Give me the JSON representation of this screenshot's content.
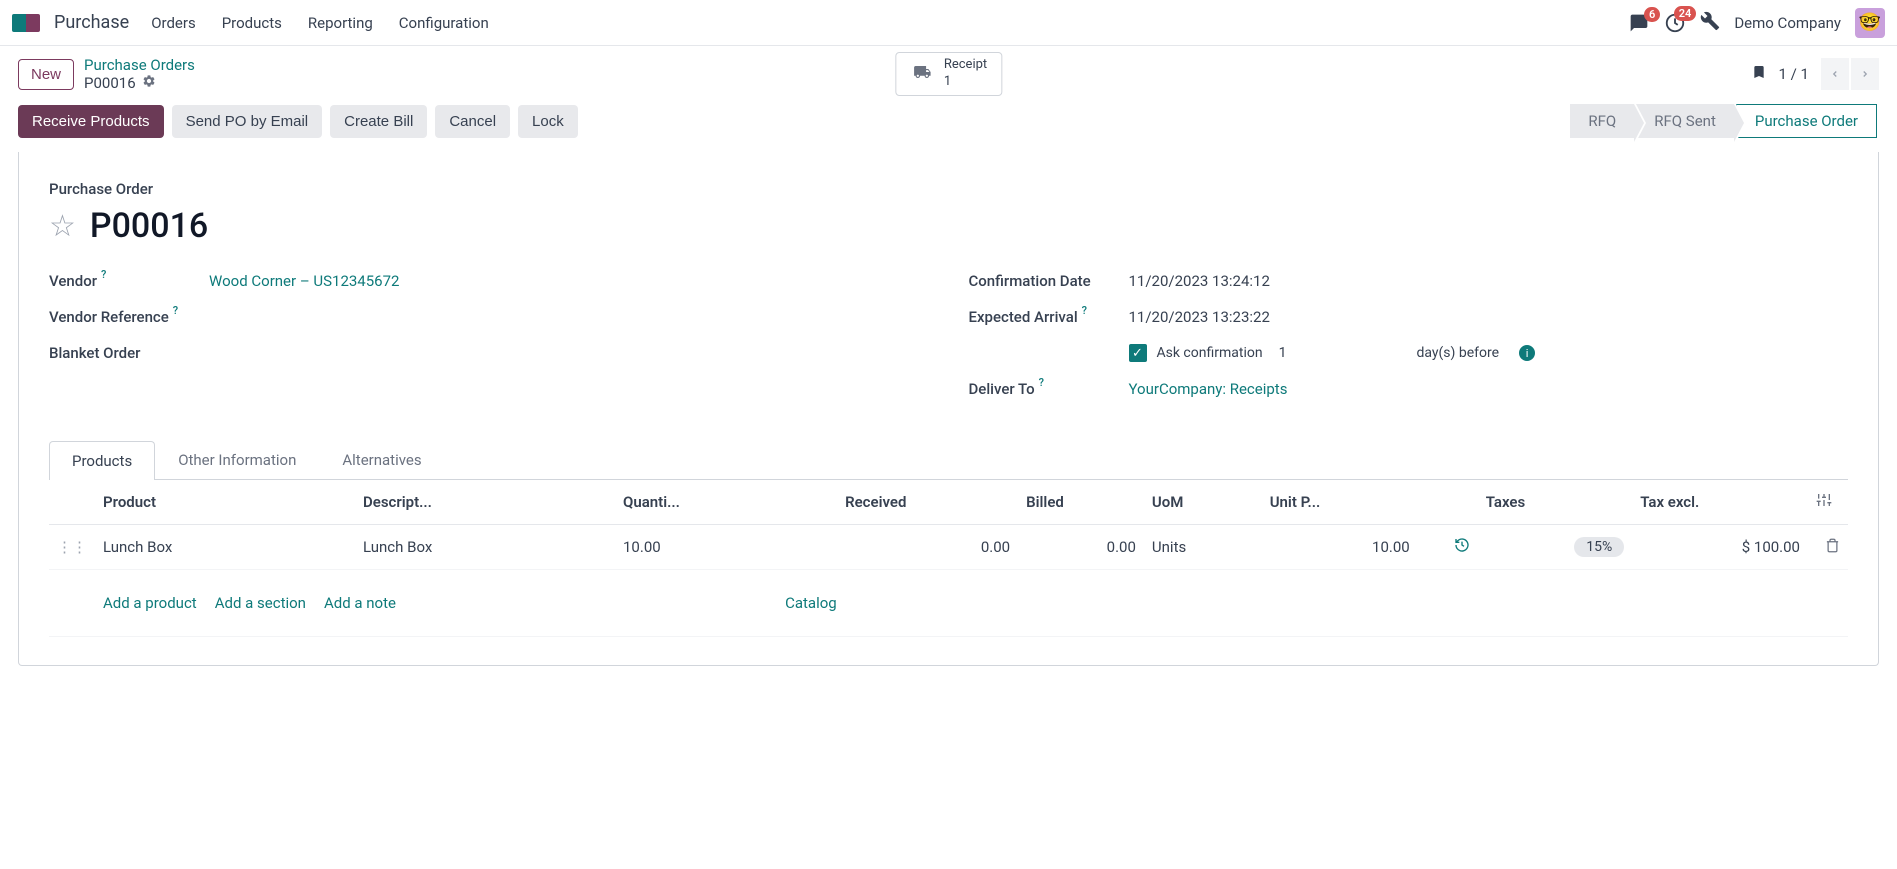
{
  "nav": {
    "app": "Purchase",
    "menu": [
      "Orders",
      "Products",
      "Reporting",
      "Configuration"
    ],
    "chat_badge": "6",
    "activity_badge": "24",
    "company": "Demo Company"
  },
  "breadcrumb": {
    "new_btn": "New",
    "parent": "Purchase Orders",
    "current": "P00016",
    "receipt_label": "Receipt",
    "receipt_count": "1",
    "pager": "1 / 1"
  },
  "actions": {
    "receive": "Receive Products",
    "send_po": "Send PO by Email",
    "create_bill": "Create Bill",
    "cancel": "Cancel",
    "lock": "Lock"
  },
  "status": {
    "rfq": "RFQ",
    "rfq_sent": "RFQ Sent",
    "po": "Purchase Order"
  },
  "header": {
    "label": "Purchase Order",
    "name": "P00016"
  },
  "fields": {
    "vendor_label": "Vendor",
    "vendor_value": "Wood Corner – US12345672",
    "vendor_ref_label": "Vendor Reference",
    "blanket_label": "Blanket Order",
    "confirm_date_label": "Confirmation Date",
    "confirm_date_value": "11/20/2023 13:24:12",
    "expected_label": "Expected Arrival",
    "expected_value": "11/20/2023 13:23:22",
    "ask_confirm_label": "Ask confirmation",
    "ask_confirm_days": "1",
    "days_before": "day(s) before",
    "deliver_to_label": "Deliver To",
    "deliver_to_value": "YourCompany: Receipts"
  },
  "tabs": {
    "products": "Products",
    "other": "Other Information",
    "alternatives": "Alternatives"
  },
  "table": {
    "headers": {
      "product": "Product",
      "description": "Descript...",
      "quantity": "Quanti...",
      "received": "Received",
      "billed": "Billed",
      "uom": "UoM",
      "unit_price": "Unit P...",
      "taxes": "Taxes",
      "tax_excl": "Tax excl."
    },
    "rows": [
      {
        "product": "Lunch Box",
        "description": "Lunch Box",
        "quantity": "10.00",
        "received": "0.00",
        "billed": "0.00",
        "uom": "Units",
        "unit_price": "10.00",
        "taxes": "15%",
        "tax_excl": "$ 100.00"
      }
    ],
    "add_product": "Add a product",
    "add_section": "Add a section",
    "add_note": "Add a note",
    "catalog": "Catalog"
  }
}
